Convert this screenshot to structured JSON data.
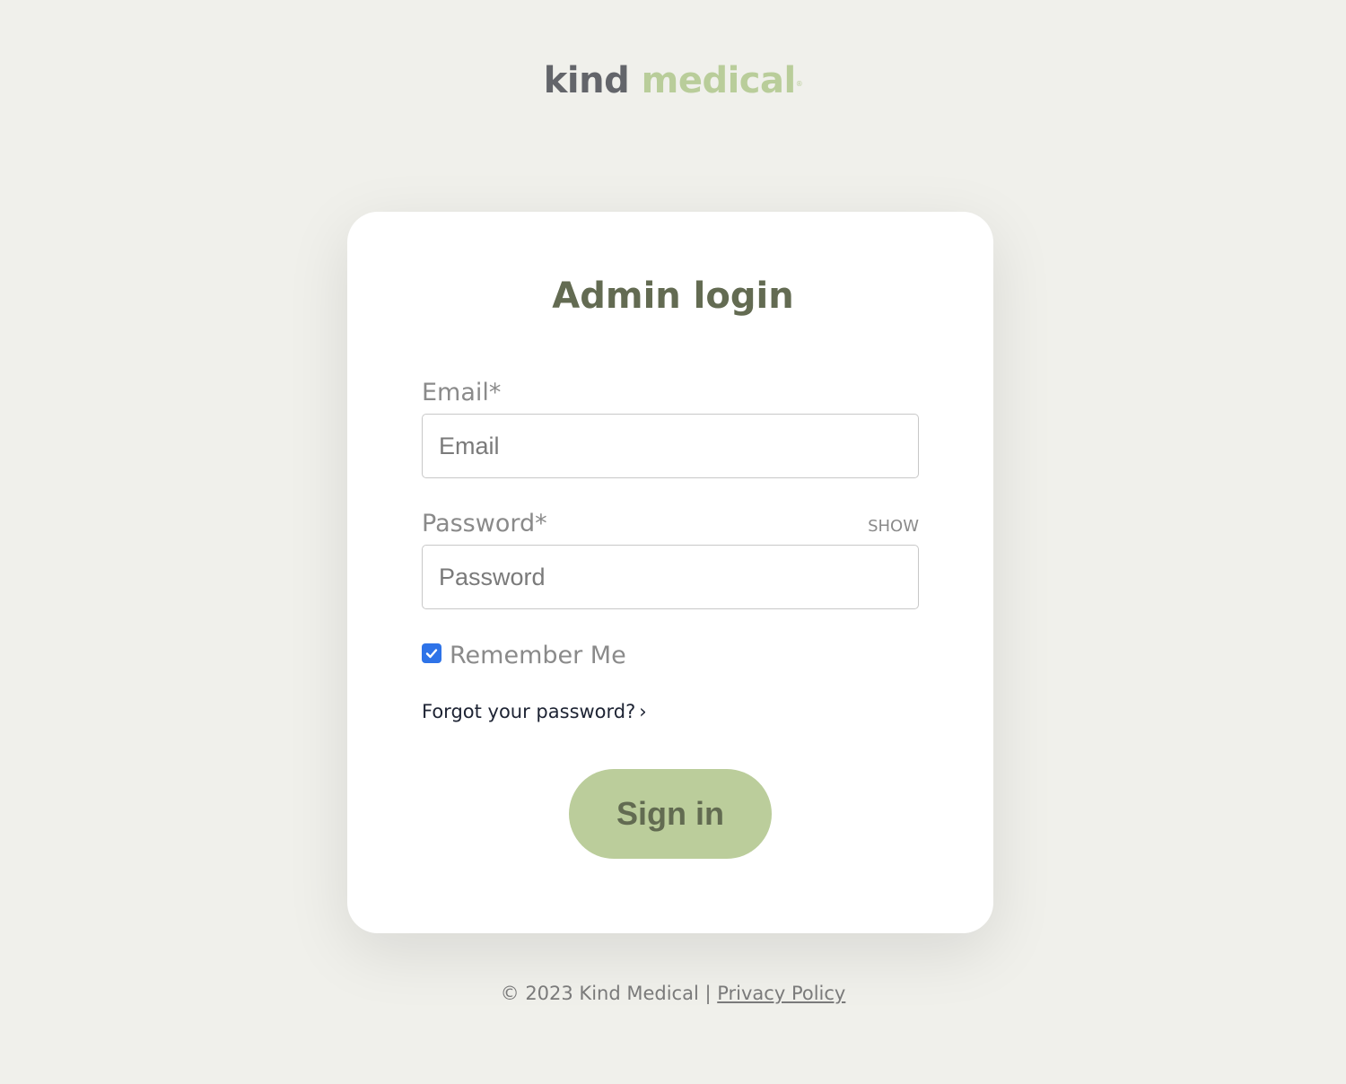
{
  "brand": {
    "part1": "kind",
    "part2": "medical",
    "registered": "®",
    "part1_color": "#63656a",
    "part2_color": "#b9cd9a"
  },
  "form": {
    "title": "Admin login",
    "email_label": "Email*",
    "email_placeholder": "Email",
    "password_label": "Password*",
    "password_placeholder": "Password",
    "show_toggle": "SHOW",
    "remember_label": "Remember Me",
    "remember_checked": true,
    "forgot_link": "Forgot your password?",
    "forgot_chevron": "›",
    "signin_label": "Sign in"
  },
  "footer": {
    "copyright": "© 2023 Kind Medical | ",
    "privacy_link": "Privacy Policy"
  },
  "colors": {
    "background": "#f0f0eb",
    "accent": "#bbcd9b",
    "title": "#636b52",
    "checkbox": "#2e73e8"
  }
}
